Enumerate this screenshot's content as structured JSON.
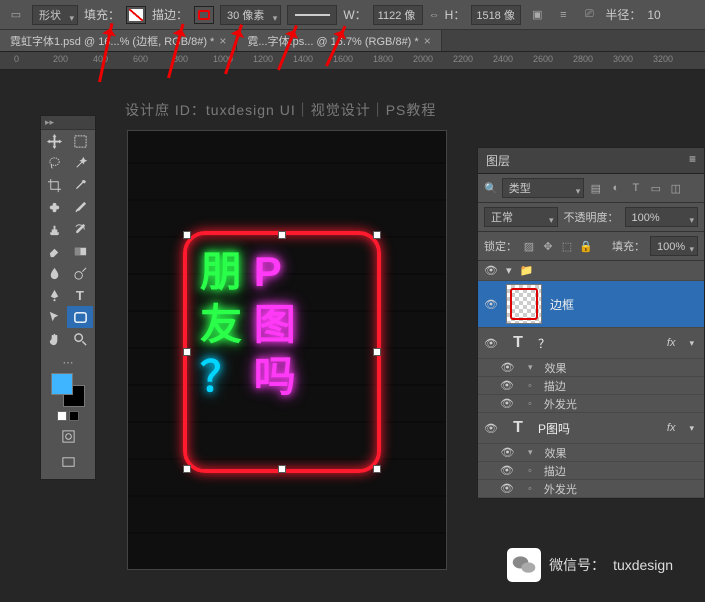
{
  "options": {
    "shape_mode": "形状",
    "fill_label": "填充：",
    "stroke_label": "描边：",
    "stroke_size": "30 像素",
    "w_label": "W：",
    "w_value": "1122 像",
    "h_label": "H：",
    "h_value": "1518 像",
    "radius_label": "半径：",
    "radius_value": "10"
  },
  "tabs": {
    "t1": "霓虹字体1.psd @ 16...% (边框, RGB/8#) *",
    "t2": "霓...字体.ps... @ 16.7% (RGB/8#) *"
  },
  "ruler_marks": [
    "0",
    "200",
    "400",
    "600",
    "800",
    "1000",
    "1200",
    "1400",
    "1600",
    "1800",
    "2000",
    "2200",
    "2400",
    "2600",
    "2800",
    "3000",
    "3200"
  ],
  "watermark": "设计庶 ID：tuxdesign      UI｜视觉设计｜PS教程",
  "canvas": {
    "text_row1_a": "朋",
    "text_row1_b": "P",
    "text_row2_a": "友",
    "text_row2_b": "图",
    "text_row3_a": "？",
    "text_row3_b": "吗"
  },
  "layers_panel": {
    "title": "图层",
    "filter_mode": "类型",
    "blend_mode": "正常",
    "opacity_label": "不透明度：",
    "opacity_value": "100%",
    "lock_label": "锁定：",
    "fill_label": "填充：",
    "fill_value": "100%",
    "layer1_name": "边框",
    "layer2_name": "？",
    "layer2_fx_head": "效果",
    "layer2_fx1": "描边",
    "layer2_fx2": "外发光",
    "layer3_name": "P图吗",
    "layer3_fx_head": "效果",
    "layer3_fx1": "描边",
    "layer3_fx2": "外发光",
    "fx_badge": "fx"
  },
  "wechat": {
    "label": "微信号：",
    "id": "tuxdesign"
  }
}
